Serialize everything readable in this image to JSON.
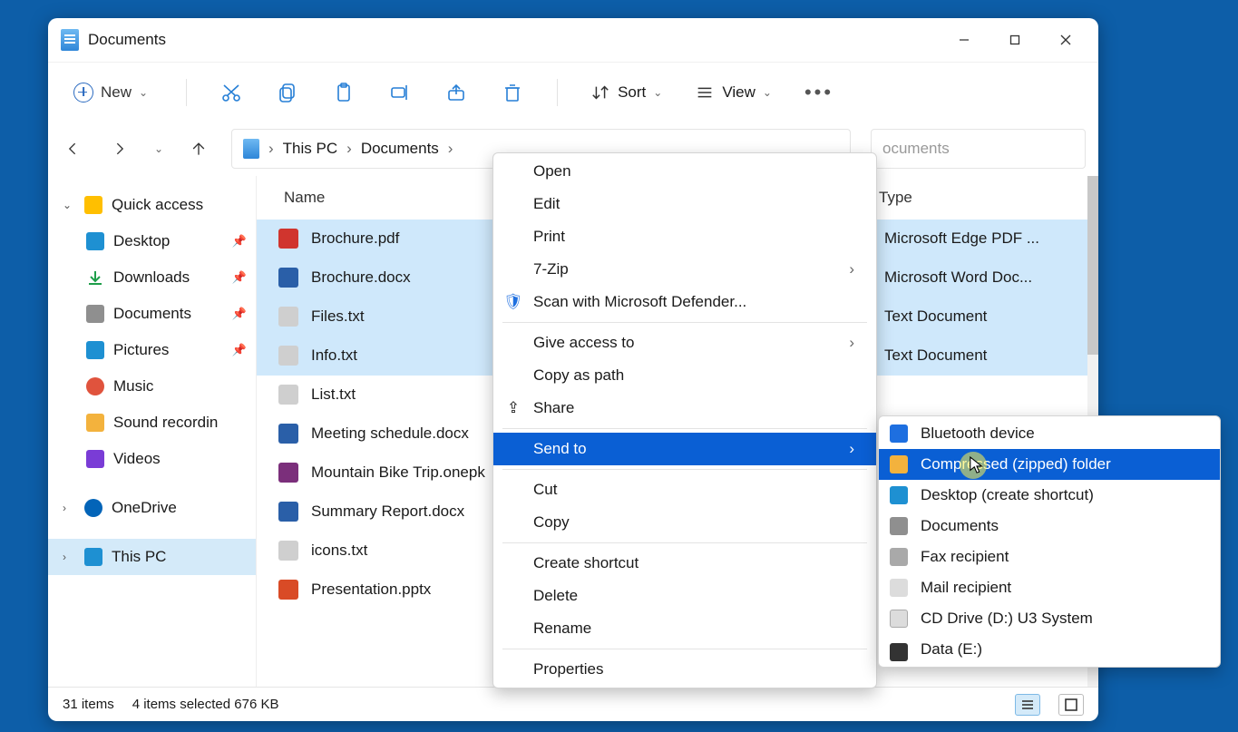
{
  "window": {
    "title": "Documents"
  },
  "toolbar": {
    "new_label": "New",
    "sort_label": "Sort",
    "view_label": "View"
  },
  "breadcrumb": {
    "seg1": "This PC",
    "seg2": "Documents"
  },
  "search": {
    "placeholder_partial": "ocuments"
  },
  "sidebar": {
    "quick_access": "Quick access",
    "items": [
      {
        "label": "Desktop",
        "pin": true
      },
      {
        "label": "Downloads",
        "pin": true
      },
      {
        "label": "Documents",
        "pin": true
      },
      {
        "label": "Pictures",
        "pin": true
      },
      {
        "label": "Music",
        "pin": false
      },
      {
        "label": "Sound recordin",
        "pin": false
      },
      {
        "label": "Videos",
        "pin": false
      }
    ],
    "onedrive": "OneDrive",
    "thispc": "This PC"
  },
  "columns": {
    "name": "Name",
    "type": "Type"
  },
  "files": [
    {
      "name": "Brochure.pdf",
      "type": "Microsoft Edge PDF ...",
      "selected": true,
      "icon": "fi-pdf"
    },
    {
      "name": "Brochure.docx",
      "type": "Microsoft Word Doc...",
      "selected": true,
      "icon": "fi-docx"
    },
    {
      "name": "Files.txt",
      "type": "Text Document",
      "selected": true,
      "icon": "fi-txt"
    },
    {
      "name": "Info.txt",
      "type": "Text Document",
      "selected": true,
      "icon": "fi-txt"
    },
    {
      "name": "List.txt",
      "type": "",
      "selected": false,
      "icon": "fi-txt"
    },
    {
      "name": "Meeting schedule.docx",
      "type": "",
      "selected": false,
      "icon": "fi-docx"
    },
    {
      "name": "Mountain Bike Trip.onepk",
      "type": "",
      "selected": false,
      "icon": "fi-one"
    },
    {
      "name": "Summary Report.docx",
      "type": "",
      "selected": false,
      "icon": "fi-docx"
    },
    {
      "name": "icons.txt",
      "type": "",
      "selected": false,
      "icon": "fi-txt"
    },
    {
      "name": "Presentation.pptx",
      "type": "",
      "selected": false,
      "icon": "fi-pptx"
    }
  ],
  "status": {
    "count": "31 items",
    "selection": "4 items selected  676 KB"
  },
  "contextmenu": {
    "open": "Open",
    "edit": "Edit",
    "print": "Print",
    "sevenzip": "7-Zip",
    "scan": "Scan with Microsoft Defender...",
    "giveaccess": "Give access to",
    "copypath": "Copy as path",
    "share": "Share",
    "sendto": "Send to",
    "cut": "Cut",
    "copy": "Copy",
    "shortcut": "Create shortcut",
    "delete": "Delete",
    "rename": "Rename",
    "properties": "Properties"
  },
  "sendto": {
    "bluetooth": "Bluetooth device",
    "zip": "Compressed (zipped) folder",
    "desktop": "Desktop (create shortcut)",
    "documents": "Documents",
    "fax": "Fax recipient",
    "mail": "Mail recipient",
    "cd": "CD Drive (D:) U3 System",
    "data": "Data (E:)"
  }
}
